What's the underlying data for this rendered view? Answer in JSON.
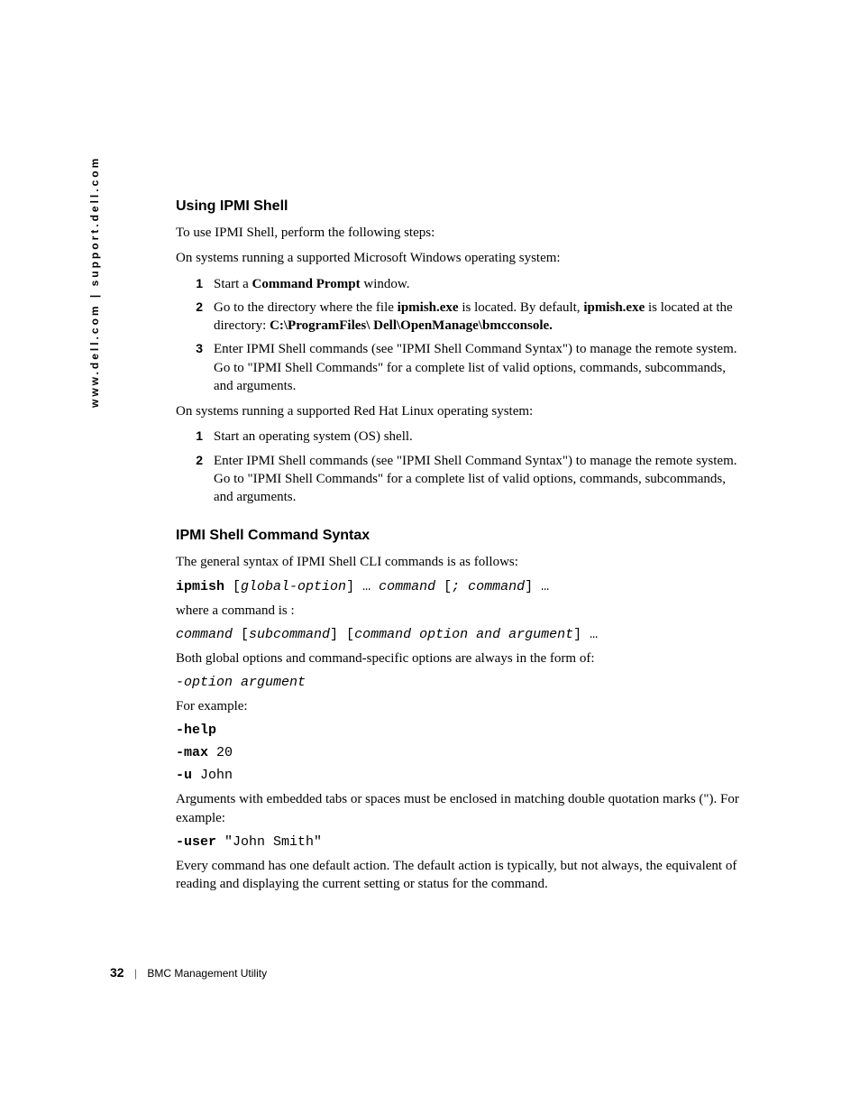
{
  "sidebar": {
    "text": "www.dell.com | support.dell.com"
  },
  "section1": {
    "heading": "Using IPMI Shell",
    "intro": "To use IPMI Shell, perform the following steps:",
    "windows_intro": "On systems running a supported Microsoft Windows operating system:",
    "steps_windows": {
      "n1": "1",
      "s1a": "Start a ",
      "s1b": "Command Prompt",
      "s1c": " window.",
      "n2": "2",
      "s2a": "Go to the directory where the file ",
      "s2b": "ipmish.exe",
      "s2c": " is located. By default, ",
      "s2d": "ipmish.exe",
      "s2e": " is located at the directory: ",
      "s2f": "C:\\ProgramFiles\\ Dell\\OpenManage\\bmcconsole.",
      "n3": "3",
      "s3": "Enter IPMI Shell commands (see \"IPMI Shell Command Syntax\") to manage the remote system. Go to \"IPMI Shell Commands\" for a complete list of valid options, commands, subcommands, and arguments."
    },
    "linux_intro": "On systems running a supported Red Hat Linux operating system:",
    "steps_linux": {
      "n1": "1",
      "s1": "Start an operating system (OS) shell.",
      "n2": "2",
      "s2": "Enter IPMI Shell commands (see \"IPMI Shell Command Syntax\") to manage the remote system. Go to \"IPMI Shell Commands\" for a complete list of valid options, commands, subcommands, and arguments."
    }
  },
  "section2": {
    "heading": "IPMI Shell Command Syntax",
    "intro": "The general syntax of IPMI Shell CLI commands is as follows:",
    "syntax1": {
      "cmd": "ipmish",
      "open1": " [",
      "globalopt": "global-option",
      "close1": "] … ",
      "command_txt": "command",
      "open2": " [",
      "semi": "; command",
      "close2": "] …"
    },
    "where": "where a command is :",
    "syntax2": {
      "command": "command",
      "open1": " [",
      "sub": "subcommand",
      "close1": "] [",
      "optarg": "command option and argument",
      "close2": "] …"
    },
    "both": "Both global options and command-specific options are always in the form of:",
    "syntax3": {
      "dash": "-",
      "opt": "option argument"
    },
    "for_example": "For example:",
    "ex1": "-help",
    "ex2a": "-max",
    "ex2b": " 20",
    "ex3a": "-u",
    "ex3b": " John",
    "args_para": "Arguments with embedded tabs or spaces must be enclosed in matching double quotation marks (\"). For example:",
    "ex4a": "-user",
    "ex4b": " \"John Smith\"",
    "final": "Every command has one default action. The default action is typically, but not always, the equivalent of reading and displaying the current setting or status for the command."
  },
  "footer": {
    "page": "32",
    "title": "BMC Management Utility"
  }
}
